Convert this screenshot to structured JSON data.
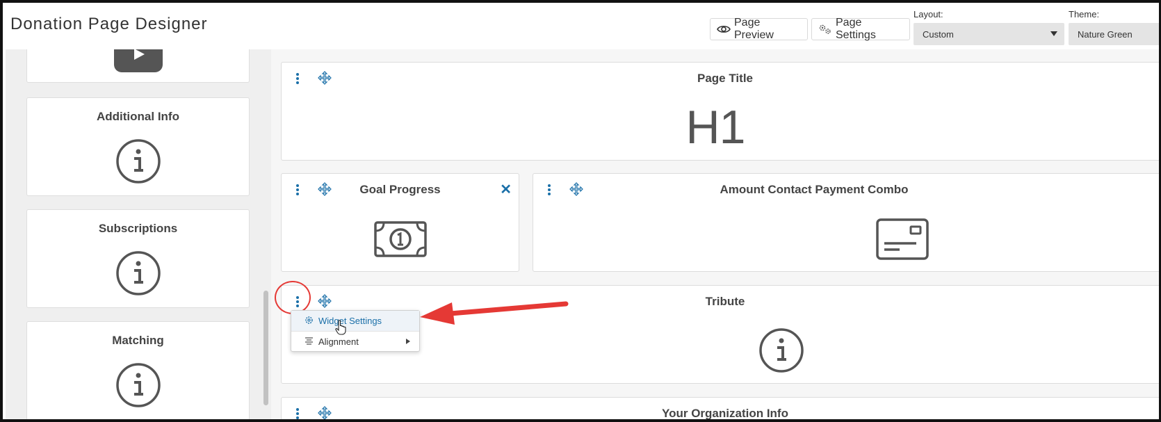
{
  "header": {
    "title": "Donation Page Designer",
    "preview_label": "Page Preview",
    "settings_label": "Page Settings",
    "layout_label": "Layout:",
    "layout_value": "Custom",
    "theme_label": "Theme:",
    "theme_value": "Nature Green"
  },
  "sidebar": {
    "items": [
      {
        "label": "",
        "icon": "video-play-icon"
      },
      {
        "label": "Additional Info",
        "icon": "info-circle-icon"
      },
      {
        "label": "Subscriptions",
        "icon": "info-circle-icon"
      },
      {
        "label": "Matching",
        "icon": "info-circle-icon"
      }
    ]
  },
  "canvas": {
    "widgets": [
      {
        "title": "Page Title",
        "content": "H1"
      },
      {
        "title": "Goal Progress",
        "icon": "money-bill-icon"
      },
      {
        "title": "Amount Contact Payment Combo",
        "icon": "credit-card-icon"
      },
      {
        "title": "Tribute",
        "icon": "info-circle-icon"
      },
      {
        "title": "Your Organization Info"
      }
    ]
  },
  "context_menu": {
    "items": [
      {
        "label": "Widget Settings",
        "icon": "gear-icon"
      },
      {
        "label": "Alignment",
        "icon": "align-icon",
        "has_submenu": true
      }
    ]
  },
  "colors": {
    "accent": "#1a6fa8",
    "annotation": "#e53935",
    "sidebar_bg": "#efefef",
    "canvas_bg": "#f6f6f6"
  }
}
